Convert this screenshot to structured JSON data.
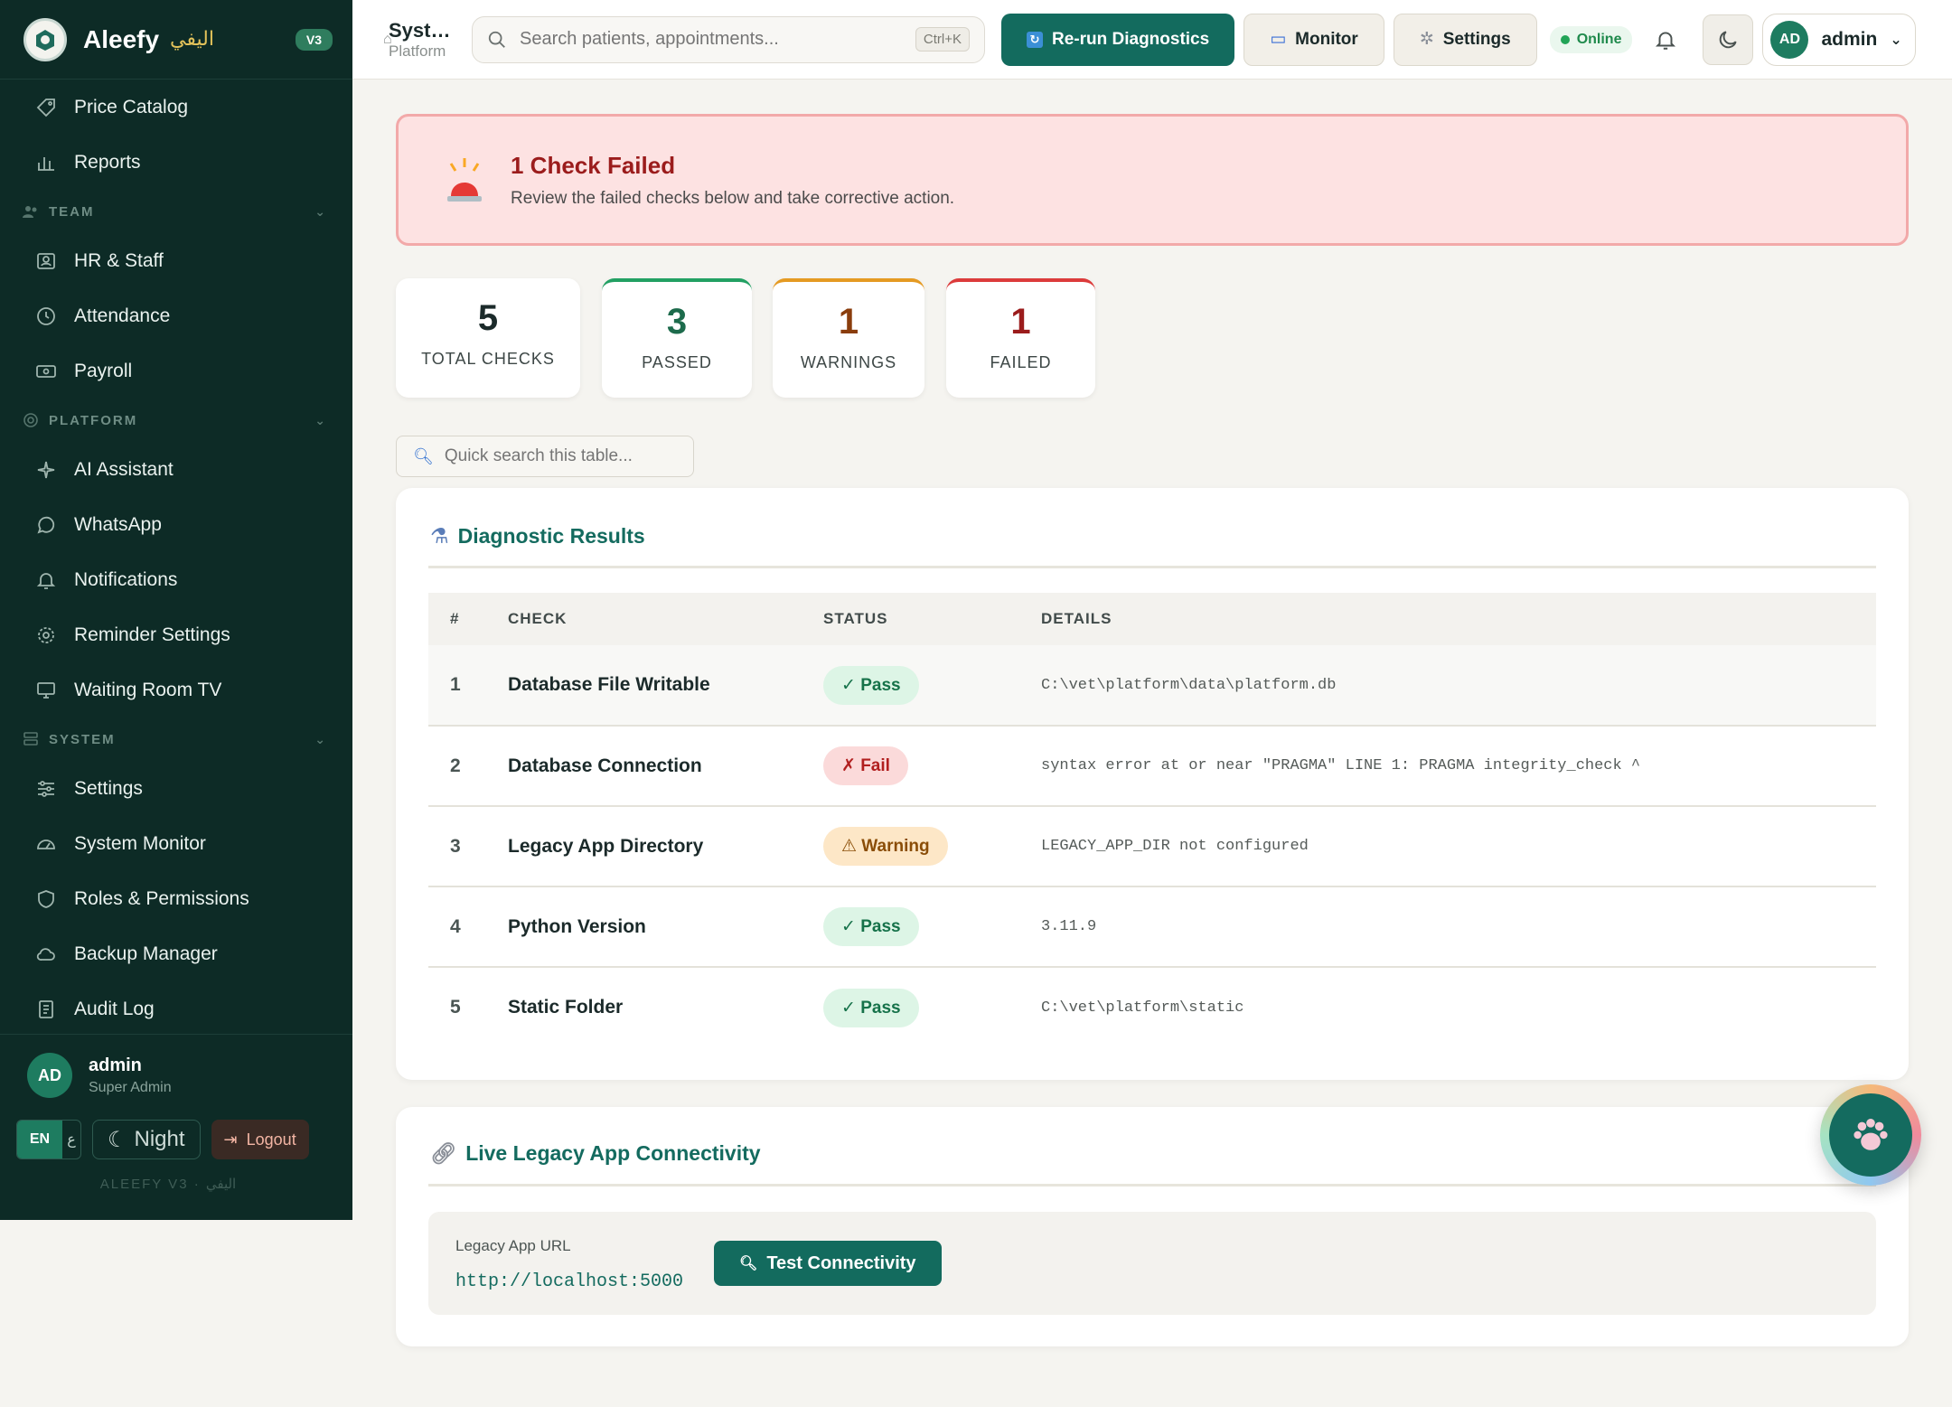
{
  "brand": {
    "name": "Aleefy",
    "name_ar": "اليفي",
    "version": "V3"
  },
  "sidebar": {
    "items_top": [
      {
        "label": "Price Catalog",
        "icon": "tag-icon"
      },
      {
        "label": "Reports",
        "icon": "bar-chart-icon"
      }
    ],
    "sections": [
      {
        "title": "TEAM",
        "icon": "users-icon",
        "items": [
          {
            "label": "HR & Staff",
            "icon": "id-card-icon"
          },
          {
            "label": "Attendance",
            "icon": "clock-icon"
          },
          {
            "label": "Payroll",
            "icon": "banknote-icon"
          }
        ]
      },
      {
        "title": "PLATFORM",
        "icon": "globe-icon",
        "items": [
          {
            "label": "AI Assistant",
            "icon": "sparkle-icon"
          },
          {
            "label": "WhatsApp",
            "icon": "whatsapp-icon"
          },
          {
            "label": "Notifications",
            "icon": "bell-icon"
          },
          {
            "label": "Reminder Settings",
            "icon": "gear-icon"
          },
          {
            "label": "Waiting Room TV",
            "icon": "monitor-icon"
          }
        ]
      },
      {
        "title": "SYSTEM",
        "icon": "server-icon",
        "items": [
          {
            "label": "Settings",
            "icon": "sliders-icon"
          },
          {
            "label": "System Monitor",
            "icon": "gauge-icon"
          },
          {
            "label": "Roles & Permissions",
            "icon": "shield-icon"
          },
          {
            "label": "Backup Manager",
            "icon": "cloud-icon"
          },
          {
            "label": "Audit Log",
            "icon": "log-icon"
          }
        ]
      }
    ],
    "user": {
      "initials": "AD",
      "name": "admin",
      "role": "Super Admin"
    },
    "lang": {
      "en": "EN",
      "ar": "ع"
    },
    "night_label": "Night",
    "logout_label": "Logout",
    "footer_note": "ALEEFY V3 · اليفي"
  },
  "topbar": {
    "crumb_title": "System Diagnostics",
    "crumb_sub": "Platform",
    "search_placeholder": "Search patients, appointments...",
    "shortcut": "Ctrl+K",
    "rerun_label": "Re-run Diagnostics",
    "monitor_label": "Monitor",
    "settings_label": "Settings",
    "status": "Online",
    "user": {
      "initials": "AD",
      "name": "admin"
    }
  },
  "alert": {
    "title": "1 Check Failed",
    "description": "Review the failed checks below and take corrective action."
  },
  "stats": [
    {
      "value": "5",
      "label": "TOTAL CHECKS"
    },
    {
      "value": "3",
      "label": "PASSED"
    },
    {
      "value": "1",
      "label": "WARNINGS"
    },
    {
      "value": "1",
      "label": "FAILED"
    }
  ],
  "table_search_placeholder": "Quick search this table...",
  "results": {
    "title": "Diagnostic Results",
    "columns": [
      "#",
      "CHECK",
      "STATUS",
      "DETAILS"
    ],
    "rows": [
      {
        "n": "1",
        "check": "Database File Writable",
        "status": "✓ Pass",
        "kind": "pass",
        "details": "C:\\vet\\platform\\data\\platform.db"
      },
      {
        "n": "2",
        "check": "Database Connection",
        "status": "✗ Fail",
        "kind": "fail",
        "details": "syntax error at or near \"PRAGMA\" LINE 1: PRAGMA integrity_check ^"
      },
      {
        "n": "3",
        "check": "Legacy App Directory",
        "status": "⚠ Warning",
        "kind": "warning",
        "details": "LEGACY_APP_DIR not configured"
      },
      {
        "n": "4",
        "check": "Python Version",
        "status": "✓ Pass",
        "kind": "pass",
        "details": "3.11.9"
      },
      {
        "n": "5",
        "check": "Static Folder",
        "status": "✓ Pass",
        "kind": "pass",
        "details": "C:\\vet\\platform\\static"
      }
    ]
  },
  "connectivity": {
    "title": "Live Legacy App Connectivity",
    "url_label": "Legacy App URL",
    "url": "http://localhost:5000",
    "button": "Test Connectivity"
  },
  "colors": {
    "brand": "#136b5e",
    "sidebar": "#0d2b26",
    "fail": "#9b1c1c"
  }
}
